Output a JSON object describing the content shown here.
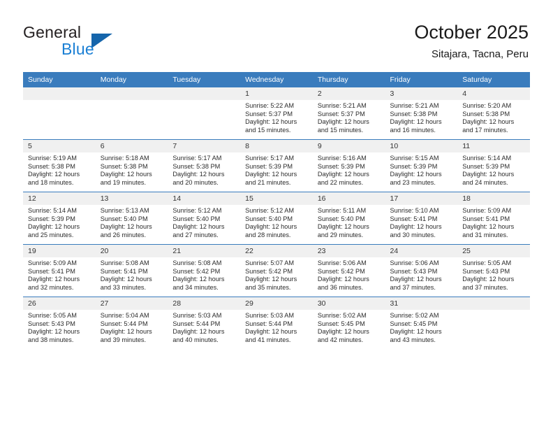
{
  "brand": {
    "name_part1": "General",
    "name_part2": "Blue",
    "logo_icon": "triangle-logo-icon"
  },
  "header": {
    "title": "October 2025",
    "subtitle": "Sitajara, Tacna, Peru"
  },
  "colors": {
    "header_blue": "#3a7cbd",
    "brand_blue": "#1a7fd4",
    "logo_blue": "#1565ab",
    "daynum_band": "#f0f0f0"
  },
  "labels": {
    "sunrise": "Sunrise:",
    "sunset": "Sunset:",
    "daylight": "Daylight:"
  },
  "weekdays": [
    "Sunday",
    "Monday",
    "Tuesday",
    "Wednesday",
    "Thursday",
    "Friday",
    "Saturday"
  ],
  "weeks": [
    [
      {
        "day": "",
        "empty": true
      },
      {
        "day": "",
        "empty": true
      },
      {
        "day": "",
        "empty": true
      },
      {
        "day": "1",
        "sunrise": "Sunrise: 5:22 AM",
        "sunset": "Sunset: 5:37 PM",
        "daylight_line1": "Daylight: 12 hours",
        "daylight_line2": "and 15 minutes."
      },
      {
        "day": "2",
        "sunrise": "Sunrise: 5:21 AM",
        "sunset": "Sunset: 5:37 PM",
        "daylight_line1": "Daylight: 12 hours",
        "daylight_line2": "and 15 minutes."
      },
      {
        "day": "3",
        "sunrise": "Sunrise: 5:21 AM",
        "sunset": "Sunset: 5:38 PM",
        "daylight_line1": "Daylight: 12 hours",
        "daylight_line2": "and 16 minutes."
      },
      {
        "day": "4",
        "sunrise": "Sunrise: 5:20 AM",
        "sunset": "Sunset: 5:38 PM",
        "daylight_line1": "Daylight: 12 hours",
        "daylight_line2": "and 17 minutes."
      }
    ],
    [
      {
        "day": "5",
        "sunrise": "Sunrise: 5:19 AM",
        "sunset": "Sunset: 5:38 PM",
        "daylight_line1": "Daylight: 12 hours",
        "daylight_line2": "and 18 minutes."
      },
      {
        "day": "6",
        "sunrise": "Sunrise: 5:18 AM",
        "sunset": "Sunset: 5:38 PM",
        "daylight_line1": "Daylight: 12 hours",
        "daylight_line2": "and 19 minutes."
      },
      {
        "day": "7",
        "sunrise": "Sunrise: 5:17 AM",
        "sunset": "Sunset: 5:38 PM",
        "daylight_line1": "Daylight: 12 hours",
        "daylight_line2": "and 20 minutes."
      },
      {
        "day": "8",
        "sunrise": "Sunrise: 5:17 AM",
        "sunset": "Sunset: 5:39 PM",
        "daylight_line1": "Daylight: 12 hours",
        "daylight_line2": "and 21 minutes."
      },
      {
        "day": "9",
        "sunrise": "Sunrise: 5:16 AM",
        "sunset": "Sunset: 5:39 PM",
        "daylight_line1": "Daylight: 12 hours",
        "daylight_line2": "and 22 minutes."
      },
      {
        "day": "10",
        "sunrise": "Sunrise: 5:15 AM",
        "sunset": "Sunset: 5:39 PM",
        "daylight_line1": "Daylight: 12 hours",
        "daylight_line2": "and 23 minutes."
      },
      {
        "day": "11",
        "sunrise": "Sunrise: 5:14 AM",
        "sunset": "Sunset: 5:39 PM",
        "daylight_line1": "Daylight: 12 hours",
        "daylight_line2": "and 24 minutes."
      }
    ],
    [
      {
        "day": "12",
        "sunrise": "Sunrise: 5:14 AM",
        "sunset": "Sunset: 5:39 PM",
        "daylight_line1": "Daylight: 12 hours",
        "daylight_line2": "and 25 minutes."
      },
      {
        "day": "13",
        "sunrise": "Sunrise: 5:13 AM",
        "sunset": "Sunset: 5:40 PM",
        "daylight_line1": "Daylight: 12 hours",
        "daylight_line2": "and 26 minutes."
      },
      {
        "day": "14",
        "sunrise": "Sunrise: 5:12 AM",
        "sunset": "Sunset: 5:40 PM",
        "daylight_line1": "Daylight: 12 hours",
        "daylight_line2": "and 27 minutes."
      },
      {
        "day": "15",
        "sunrise": "Sunrise: 5:12 AM",
        "sunset": "Sunset: 5:40 PM",
        "daylight_line1": "Daylight: 12 hours",
        "daylight_line2": "and 28 minutes."
      },
      {
        "day": "16",
        "sunrise": "Sunrise: 5:11 AM",
        "sunset": "Sunset: 5:40 PM",
        "daylight_line1": "Daylight: 12 hours",
        "daylight_line2": "and 29 minutes."
      },
      {
        "day": "17",
        "sunrise": "Sunrise: 5:10 AM",
        "sunset": "Sunset: 5:41 PM",
        "daylight_line1": "Daylight: 12 hours",
        "daylight_line2": "and 30 minutes."
      },
      {
        "day": "18",
        "sunrise": "Sunrise: 5:09 AM",
        "sunset": "Sunset: 5:41 PM",
        "daylight_line1": "Daylight: 12 hours",
        "daylight_line2": "and 31 minutes."
      }
    ],
    [
      {
        "day": "19",
        "sunrise": "Sunrise: 5:09 AM",
        "sunset": "Sunset: 5:41 PM",
        "daylight_line1": "Daylight: 12 hours",
        "daylight_line2": "and 32 minutes."
      },
      {
        "day": "20",
        "sunrise": "Sunrise: 5:08 AM",
        "sunset": "Sunset: 5:41 PM",
        "daylight_line1": "Daylight: 12 hours",
        "daylight_line2": "and 33 minutes."
      },
      {
        "day": "21",
        "sunrise": "Sunrise: 5:08 AM",
        "sunset": "Sunset: 5:42 PM",
        "daylight_line1": "Daylight: 12 hours",
        "daylight_line2": "and 34 minutes."
      },
      {
        "day": "22",
        "sunrise": "Sunrise: 5:07 AM",
        "sunset": "Sunset: 5:42 PM",
        "daylight_line1": "Daylight: 12 hours",
        "daylight_line2": "and 35 minutes."
      },
      {
        "day": "23",
        "sunrise": "Sunrise: 5:06 AM",
        "sunset": "Sunset: 5:42 PM",
        "daylight_line1": "Daylight: 12 hours",
        "daylight_line2": "and 36 minutes."
      },
      {
        "day": "24",
        "sunrise": "Sunrise: 5:06 AM",
        "sunset": "Sunset: 5:43 PM",
        "daylight_line1": "Daylight: 12 hours",
        "daylight_line2": "and 37 minutes."
      },
      {
        "day": "25",
        "sunrise": "Sunrise: 5:05 AM",
        "sunset": "Sunset: 5:43 PM",
        "daylight_line1": "Daylight: 12 hours",
        "daylight_line2": "and 37 minutes."
      }
    ],
    [
      {
        "day": "26",
        "sunrise": "Sunrise: 5:05 AM",
        "sunset": "Sunset: 5:43 PM",
        "daylight_line1": "Daylight: 12 hours",
        "daylight_line2": "and 38 minutes."
      },
      {
        "day": "27",
        "sunrise": "Sunrise: 5:04 AM",
        "sunset": "Sunset: 5:44 PM",
        "daylight_line1": "Daylight: 12 hours",
        "daylight_line2": "and 39 minutes."
      },
      {
        "day": "28",
        "sunrise": "Sunrise: 5:03 AM",
        "sunset": "Sunset: 5:44 PM",
        "daylight_line1": "Daylight: 12 hours",
        "daylight_line2": "and 40 minutes."
      },
      {
        "day": "29",
        "sunrise": "Sunrise: 5:03 AM",
        "sunset": "Sunset: 5:44 PM",
        "daylight_line1": "Daylight: 12 hours",
        "daylight_line2": "and 41 minutes."
      },
      {
        "day": "30",
        "sunrise": "Sunrise: 5:02 AM",
        "sunset": "Sunset: 5:45 PM",
        "daylight_line1": "Daylight: 12 hours",
        "daylight_line2": "and 42 minutes."
      },
      {
        "day": "31",
        "sunrise": "Sunrise: 5:02 AM",
        "sunset": "Sunset: 5:45 PM",
        "daylight_line1": "Daylight: 12 hours",
        "daylight_line2": "and 43 minutes."
      },
      {
        "day": "",
        "empty": true
      }
    ]
  ]
}
